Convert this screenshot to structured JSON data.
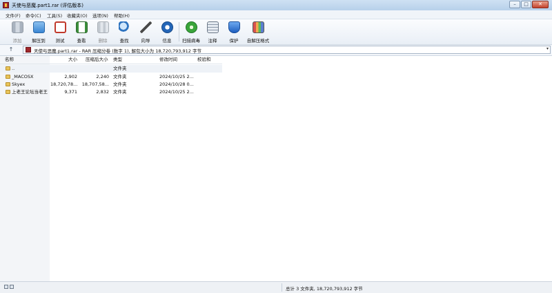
{
  "window": {
    "title": "天使与恶魔.part1.rar (评估版本)",
    "minimize": "–",
    "maximize": "□",
    "close": "✕"
  },
  "menu": [
    "文件(F)",
    "命令(C)",
    "工具(S)",
    "收藏夹(O)",
    "选项(N)",
    "帮助(H)"
  ],
  "toolbar": {
    "add": "添加",
    "extract_to": "解压到",
    "test": "测试",
    "view": "查看",
    "delete": "删除",
    "find": "查找",
    "wizard": "向导",
    "info": "信息",
    "virus_scan": "扫描病毒",
    "comment": "注释",
    "protect": "保护",
    "sfx": "自解压格式"
  },
  "address": {
    "up": "↑",
    "path": "天使与恶魔.part1.rar - RAR 压缩分卷 (数字 1), 解包大小为 18,720,793,912 字节",
    "dropdown": "▾"
  },
  "columns": [
    "名称",
    "大小",
    "压缩后大小",
    "类型",
    "修改时间",
    "校验和"
  ],
  "files": [
    {
      "name": "..",
      "size": "",
      "packed": "",
      "type": "文件夹",
      "modified": "",
      "crc": ""
    },
    {
      "name": "_MACOSX",
      "size": "2,902",
      "packed": "2,240",
      "type": "文件夹",
      "modified": "2024/10/25 2...",
      "crc": ""
    },
    {
      "name": "Skyex",
      "size": "18,720,78...",
      "packed": "18,707,58...",
      "type": "文件夹",
      "modified": "2024/10/28 0...",
      "crc": ""
    },
    {
      "name": "上老王论坛当老王",
      "size": "9,371",
      "packed": "2,832",
      "type": "文件夹",
      "modified": "2024/10/25 2...",
      "crc": ""
    }
  ],
  "status": {
    "summary": "总计 3 文件夹, 18,720,793,912 字节"
  },
  "colors": {
    "titlebar": "#b7d0ea",
    "accent": "#a0282c"
  }
}
